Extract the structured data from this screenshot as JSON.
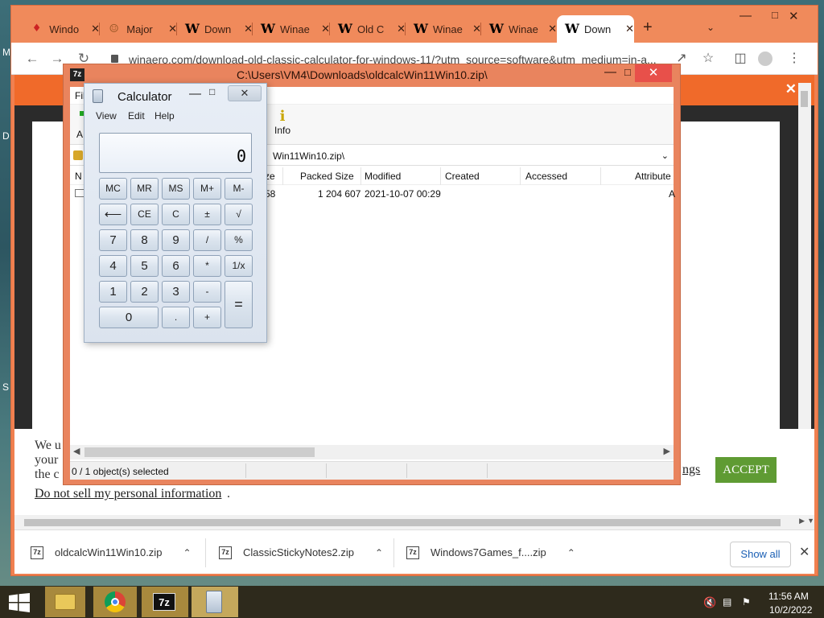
{
  "desktop": {
    "left_edge_chars": [
      "M",
      "D",
      "S"
    ]
  },
  "chrome": {
    "tabs": [
      {
        "title": "Windo",
        "icon": "card-favicon"
      },
      {
        "title": "Major",
        "icon": "geek-favicon"
      },
      {
        "title": "Down",
        "icon": "winaero-favicon"
      },
      {
        "title": "Winae",
        "icon": "winaero-favicon"
      },
      {
        "title": "Old C",
        "icon": "winaero-favicon"
      },
      {
        "title": "Winae",
        "icon": "winaero-favicon"
      },
      {
        "title": "Winae",
        "icon": "winaero-favicon"
      },
      {
        "title": "Down",
        "icon": "winaero-favicon",
        "active": true
      }
    ],
    "favicon_letter": "W",
    "new_tab": "+",
    "tab_close": "✕",
    "url": "winaero.com/download-old-classic-calculator-for-windows-11/?utm_source=software&utm_medium=in-a...",
    "cookie": {
      "line1": "We u",
      "line2": "your",
      "line3": "the c",
      "settings_fragment": "ngs",
      "do_not_sell": "Do not sell my personal information",
      "period": ".",
      "accept": "ACCEPT"
    },
    "downloads": [
      {
        "name": "oldcalcWin11Win10.zip"
      },
      {
        "name": "ClassicStickyNotes2.zip"
      },
      {
        "name": "Windows7Games_f....zip"
      }
    ],
    "show_all": "Show all",
    "accent": "#f08a5b",
    "banner_color": "#f06a2a",
    "accept_color": "#5f9b33"
  },
  "sevenzip": {
    "icon_label": "7z",
    "title": "C:\\Users\\VM4\\Downloads\\oldcalcWin11Win10.zip\\",
    "menu_fragment": "Fil",
    "toolbar_fragment": "A",
    "info_label": "Info",
    "info_glyph": "i",
    "path": "Win11Win10.zip\\",
    "columns": {
      "name_fragment": "N",
      "size_fragment": "ze",
      "packed_size": "Packed Size",
      "modified": "Modified",
      "created": "Created",
      "accessed": "Accessed",
      "attributes": "Attribute"
    },
    "row": {
      "size_fragment": "58",
      "packed_size": "1 204 607",
      "modified": "2021-10-07 00:29",
      "attr_fragment": "A"
    },
    "status": "0 / 1 object(s) selected",
    "frame_color": "#e9845e"
  },
  "calculator": {
    "title": "Calculator",
    "menu": [
      "View",
      "Edit",
      "Help"
    ],
    "display": "0",
    "buttons": {
      "mc": "MC",
      "mr": "MR",
      "ms": "MS",
      "mplus": "M+",
      "mminus": "M-",
      "back": "⟵",
      "ce": "CE",
      "c": "C",
      "plusminus": "±",
      "sqrt": "√",
      "n7": "7",
      "n8": "8",
      "n9": "9",
      "div": "/",
      "pct": "%",
      "n4": "4",
      "n5": "5",
      "n6": "6",
      "mul": "*",
      "recip": "1/x",
      "n1": "1",
      "n2": "2",
      "n3": "3",
      "sub": "-",
      "eq": "=",
      "n0": "0",
      "dot": ".",
      "add": "+"
    }
  },
  "taskbar": {
    "time": "11:56 AM",
    "date": "10/2/2022",
    "apps": [
      "file-explorer-icon",
      "chrome-icon",
      "7zip-icon",
      "calculator-icon"
    ],
    "sevenzip_label": "7z"
  }
}
